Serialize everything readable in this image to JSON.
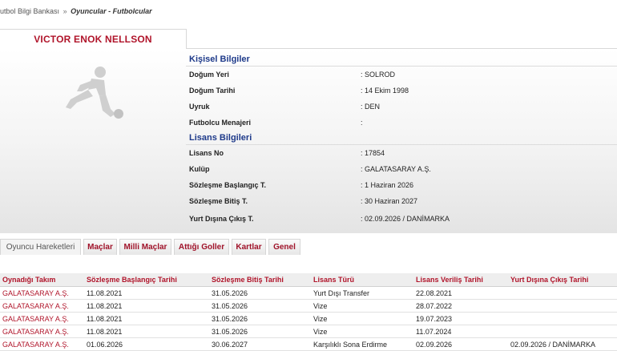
{
  "breadcrumb": {
    "root": "utbol Bilgi Bankası",
    "separator": "»",
    "current": "Oyuncular - Futbolcular"
  },
  "player": {
    "name": "VICTOR ENOK NELLSON",
    "avatar_icon": "soccer-player-silhouette-icon"
  },
  "personal": {
    "title": "Kişisel Bilgiler",
    "fields": [
      {
        "label": "Doğum Yeri",
        "value": ":  SOLROD"
      },
      {
        "label": "Doğum Tarihi",
        "value": ":  14 Ekim 1998"
      },
      {
        "label": "Uyruk",
        "value": ":  DEN"
      },
      {
        "label": "Futbolcu Menajeri",
        "value": ":"
      }
    ]
  },
  "license": {
    "title": "Lisans Bilgileri",
    "fields": [
      {
        "label": "Lisans No",
        "value": ": 17854"
      },
      {
        "label": "Kulüp",
        "value": ": GALATASARAY A.Ş."
      },
      {
        "label": "Sözleşme Başlangıç T.",
        "value": ": 1 Haziran 2026"
      },
      {
        "label": "Sözleşme Bitiş T.",
        "value": ": 30 Haziran 2027"
      },
      {
        "label": "Yurt Dışına Çıkış T.",
        "value": ": 02.09.2026 / DANİMARKA"
      }
    ]
  },
  "tabs": [
    {
      "label": "Oyuncu Hareketleri",
      "active": true
    },
    {
      "label": "Maçlar",
      "active": false
    },
    {
      "label": "Milli Maçlar",
      "active": false
    },
    {
      "label": "Attığı Goller",
      "active": false
    },
    {
      "label": "Kartlar",
      "active": false
    },
    {
      "label": "Genel",
      "active": false
    }
  ],
  "table": {
    "columns": [
      "Oynadığı Takım",
      "Sözleşme Başlangıç Tarihi",
      "Sözleşme Bitiş Tarihi",
      "Lisans Türü",
      "Lisans Veriliş Tarihi",
      "Yurt Dışına Çıkış Tarihi"
    ],
    "rows": [
      [
        "GALATASARAY A.Ş.",
        "11.08.2021",
        "31.05.2026",
        "Yurt Dışı Transfer",
        "22.08.2021",
        ""
      ],
      [
        "GALATASARAY A.Ş.",
        "11.08.2021",
        "31.05.2026",
        "Vize",
        "28.07.2022",
        ""
      ],
      [
        "GALATASARAY A.Ş.",
        "11.08.2021",
        "31.05.2026",
        "Vize",
        "19.07.2023",
        ""
      ],
      [
        "GALATASARAY A.Ş.",
        "11.08.2021",
        "31.05.2026",
        "Vize",
        "11.07.2024",
        ""
      ],
      [
        "GALATASARAY A.Ş.",
        "01.06.2026",
        "30.06.2027",
        "Karşılıklı Sona Erdirme",
        "02.09.2026",
        "02.09.2026 / DANİMARKA"
      ]
    ]
  },
  "colors": {
    "accent_red": "#b0142a",
    "section_blue": "#1e3a8a"
  }
}
